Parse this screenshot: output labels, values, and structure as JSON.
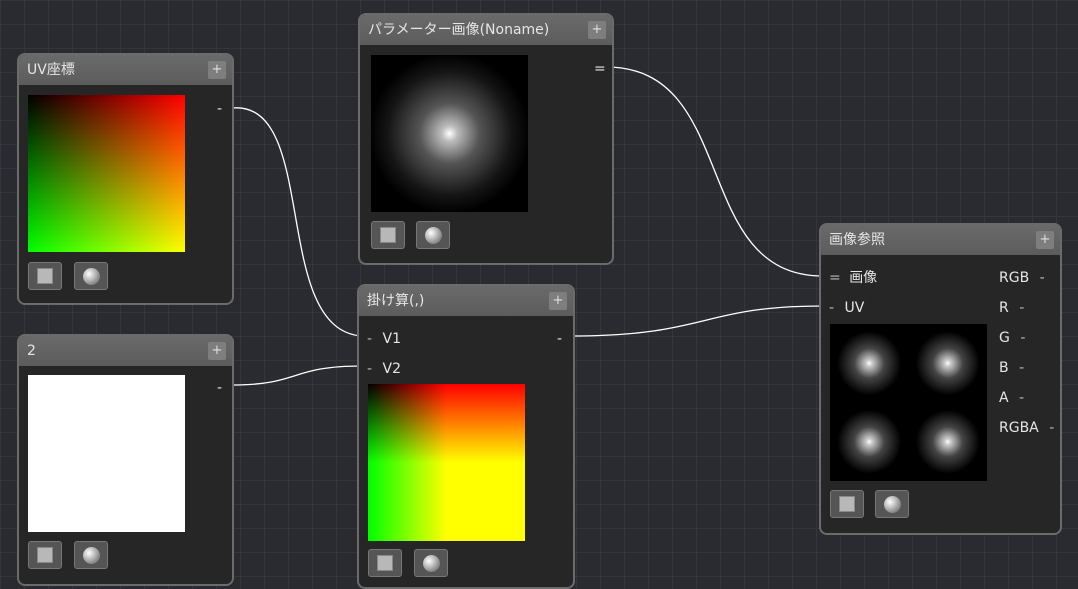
{
  "nodes": {
    "uv": {
      "title": "UV座標",
      "plus": "+",
      "out": "-"
    },
    "param": {
      "title": "パラメーター画像(Noname)",
      "plus": "+",
      "out": "="
    },
    "two": {
      "title": "2",
      "plus": "+",
      "out": "-"
    },
    "mul": {
      "title": "掛け算(,)",
      "plus": "+",
      "in_v1": "V1",
      "in_v2": "V2",
      "in_dash": "-",
      "out": "-"
    },
    "ref": {
      "title": "画像参照",
      "plus": "+",
      "in_image": "画像",
      "in_image_mark": "=",
      "in_uv": "UV",
      "in_uv_mark": "-",
      "outs": [
        "RGB",
        "R",
        "G",
        "B",
        "A",
        "RGBA"
      ],
      "out_mark": "-"
    }
  },
  "colors": {
    "wire": "#ffffff",
    "header": "#626262",
    "border": "#6b6b6b"
  }
}
